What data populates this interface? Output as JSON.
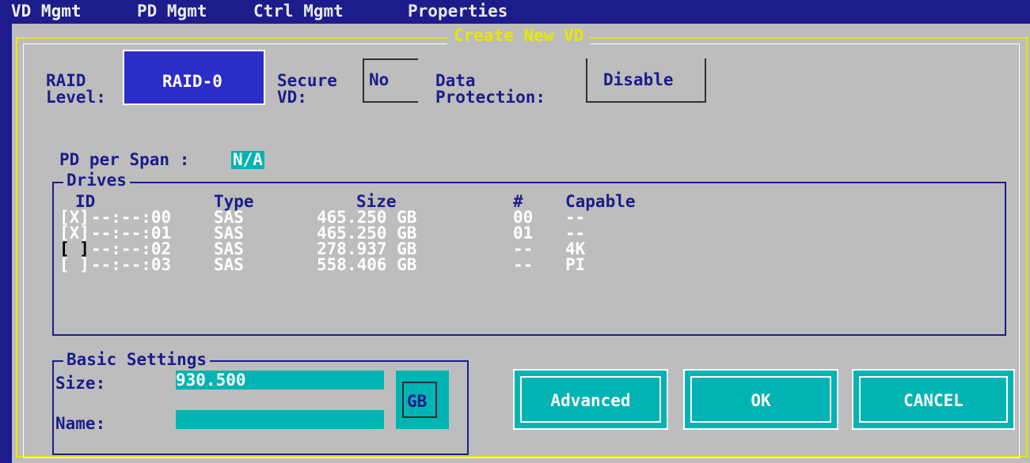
{
  "menu": {
    "items": [
      {
        "label": "VD Mgmt"
      },
      {
        "label": "PD Mgmt"
      },
      {
        "label": "Ctrl Mgmt"
      },
      {
        "label": "Properties"
      }
    ]
  },
  "dialog": {
    "title": "Create New VD",
    "raid_level": {
      "label_1": "RAID",
      "label_2": "Level:",
      "value": "RAID-0"
    },
    "secure_vd": {
      "label_1": "Secure",
      "label_2": "VD:",
      "value": "No"
    },
    "data_protection": {
      "label_1": "Data",
      "label_2": "Protection:",
      "value": "Disable"
    },
    "pd_per_span": {
      "label": "PD per Span :",
      "value": "N/A"
    },
    "drives": {
      "title": "Drives",
      "headers": {
        "id": "ID",
        "type": "Type",
        "size": "Size",
        "num": "#",
        "capable": "Capable"
      },
      "rows": [
        {
          "check": "[X]",
          "id": "--:--:00",
          "type": "SAS",
          "size": "465.250 GB",
          "num": "00",
          "capable": "--"
        },
        {
          "check": "[X]",
          "id": "--:--:01",
          "type": "SAS",
          "size": "465.250 GB",
          "num": "01",
          "capable": "--"
        },
        {
          "check": "[ ]",
          "id": "--:--:02",
          "type": "SAS",
          "size": "278.937 GB",
          "num": "--",
          "capable": "4K"
        },
        {
          "check": "[ ]",
          "id": "--:--:03",
          "type": "SAS",
          "size": "558.406 GB",
          "num": "--",
          "capable": "PI"
        }
      ]
    },
    "basic_settings": {
      "title": "Basic Settings",
      "size_label": "Size:",
      "size_value": "930.500",
      "name_label": "Name:",
      "name_value": "",
      "unit": "GB"
    },
    "buttons": {
      "advanced": "Advanced",
      "ok": "OK",
      "cancel": "CANCEL"
    }
  },
  "colors": {
    "navy": "#1c1c8c",
    "panel_gray": "#bdbdbd",
    "cyan": "#00b4b4",
    "yellow": "#e8e800",
    "selected_blue": "#2c2cc8"
  }
}
